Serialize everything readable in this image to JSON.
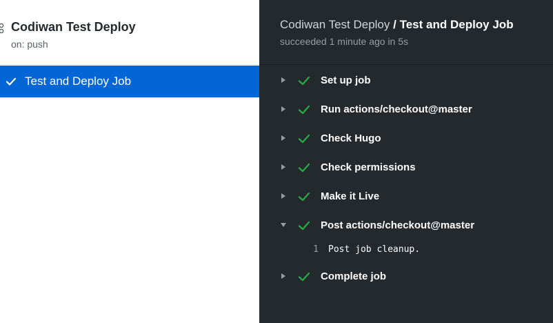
{
  "workflow": {
    "title": "Codiwan Test Deploy",
    "trigger": "on: push"
  },
  "job_list": {
    "items": [
      {
        "label": "Test and Deploy Job",
        "status": "success",
        "selected": true
      }
    ]
  },
  "job_header": {
    "workflow_name": "Codiwan Test Deploy",
    "separator": "/",
    "job_name": "Test and Deploy Job",
    "status_text": "succeeded 1 minute ago in 5s"
  },
  "steps": [
    {
      "label": "Set up job",
      "status": "success",
      "expanded": false
    },
    {
      "label": "Run actions/checkout@master",
      "status": "success",
      "expanded": false
    },
    {
      "label": "Check Hugo",
      "status": "success",
      "expanded": false
    },
    {
      "label": "Check permissions",
      "status": "success",
      "expanded": false
    },
    {
      "label": "Make it Live",
      "status": "success",
      "expanded": false
    },
    {
      "label": "Post actions/checkout@master",
      "status": "success",
      "expanded": true,
      "log": [
        {
          "line": "1",
          "text": "Post job cleanup."
        }
      ]
    },
    {
      "label": "Complete job",
      "status": "success",
      "expanded": false
    }
  ],
  "colors": {
    "accent": "#0366d6",
    "success": "#28a745",
    "dark_bg": "#24292e"
  },
  "icons": {
    "workflow": "workflow-icon",
    "check": "check-icon",
    "caret_right": "caret-right-icon",
    "caret_down": "caret-down-icon"
  }
}
